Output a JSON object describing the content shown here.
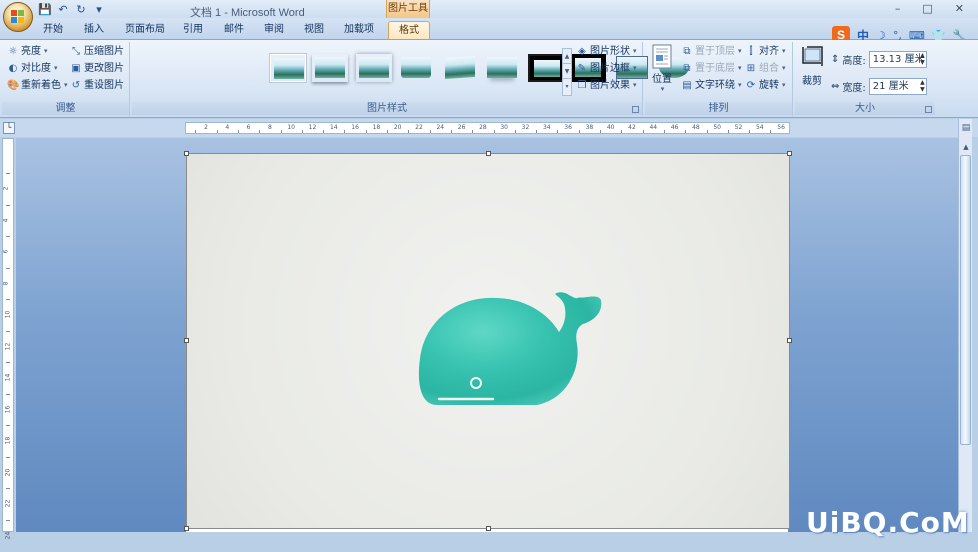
{
  "window": {
    "title": "文档 1 - Microsoft Word",
    "context_tab": "图片工具",
    "controls": [
      "–",
      "□",
      "✕"
    ]
  },
  "quick_access": {
    "icons": [
      "save-icon",
      "undo-icon",
      "redo-icon",
      "customize-icon"
    ]
  },
  "tabs": [
    {
      "label": "开始"
    },
    {
      "label": "插入"
    },
    {
      "label": "页面布局"
    },
    {
      "label": "引用"
    },
    {
      "label": "邮件"
    },
    {
      "label": "审阅"
    },
    {
      "label": "视图"
    },
    {
      "label": "加载项"
    },
    {
      "label": "格式",
      "active": true
    }
  ],
  "ime": {
    "logo": "S",
    "mode": "中",
    "symbols": [
      "☽",
      "°,",
      "⌨",
      "👕",
      "🔧"
    ]
  },
  "ribbon": {
    "adjust": {
      "label": "调整",
      "brightness": "亮度",
      "contrast": "对比度",
      "recolor": "重新着色",
      "compress": "压缩图片",
      "change": "更改图片",
      "reset": "重设图片"
    },
    "styles": {
      "label": "图片样式",
      "shape": "图片形状",
      "border": "图片边框",
      "effects": "图片效果"
    },
    "arrange": {
      "label": "排列",
      "position": "位置",
      "front": "置于顶层",
      "back": "置于底层",
      "wrap": "文字环绕",
      "align": "对齐",
      "group": "组合",
      "rotate": "旋转"
    },
    "size": {
      "label": "大小",
      "crop": "裁剪",
      "height_label": "高度:",
      "height_value": "13.13 厘米",
      "width_label": "宽度:",
      "width_value": "21 厘米"
    }
  },
  "ruler": {
    "h_labels": [
      "2",
      "4",
      "6",
      "8",
      "10",
      "12",
      "14",
      "16",
      "18",
      "20",
      "22",
      "24",
      "26",
      "28",
      "30",
      "32",
      "34",
      "36",
      "38",
      "40",
      "42",
      "44",
      "46",
      "48",
      "50",
      "52",
      "54",
      "56"
    ],
    "v_labels": [
      "2",
      "4",
      "6",
      "8",
      "10",
      "12",
      "14",
      "16",
      "18",
      "20",
      "22",
      "24"
    ]
  },
  "watermark": "UiBQ.CoM"
}
